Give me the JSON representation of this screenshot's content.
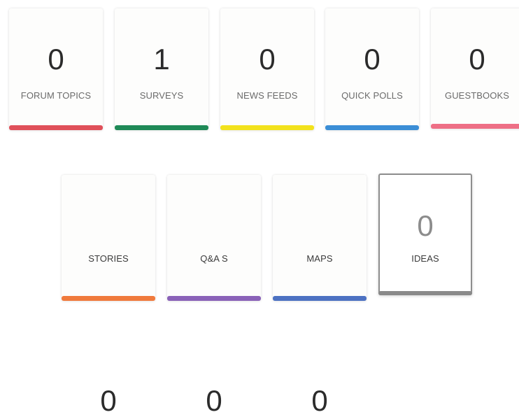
{
  "cards": [
    {
      "count": "0",
      "label": "FORUM TOPICS",
      "color": "#e0505a"
    },
    {
      "count": "1",
      "label": "SURVEYS",
      "color": "#1f8a57"
    },
    {
      "count": "0",
      "label": "NEWS FEEDS",
      "color": "#f2e21c"
    },
    {
      "count": "0",
      "label": "QUICK POLLS",
      "color": "#3b8ed6"
    },
    {
      "count": "0",
      "label": "GUESTBOOKS",
      "color": "#ee6f86"
    },
    {
      "count": "0",
      "label": "STORIES",
      "color": "#f07a3c"
    },
    {
      "count": "0",
      "label": "Q&A S",
      "color": "#8a62b8"
    },
    {
      "count": "0",
      "label": "MAPS",
      "color": "#4d72c2"
    },
    {
      "count": "0",
      "label": "IDEAS",
      "color": "#8a8a8a"
    }
  ]
}
